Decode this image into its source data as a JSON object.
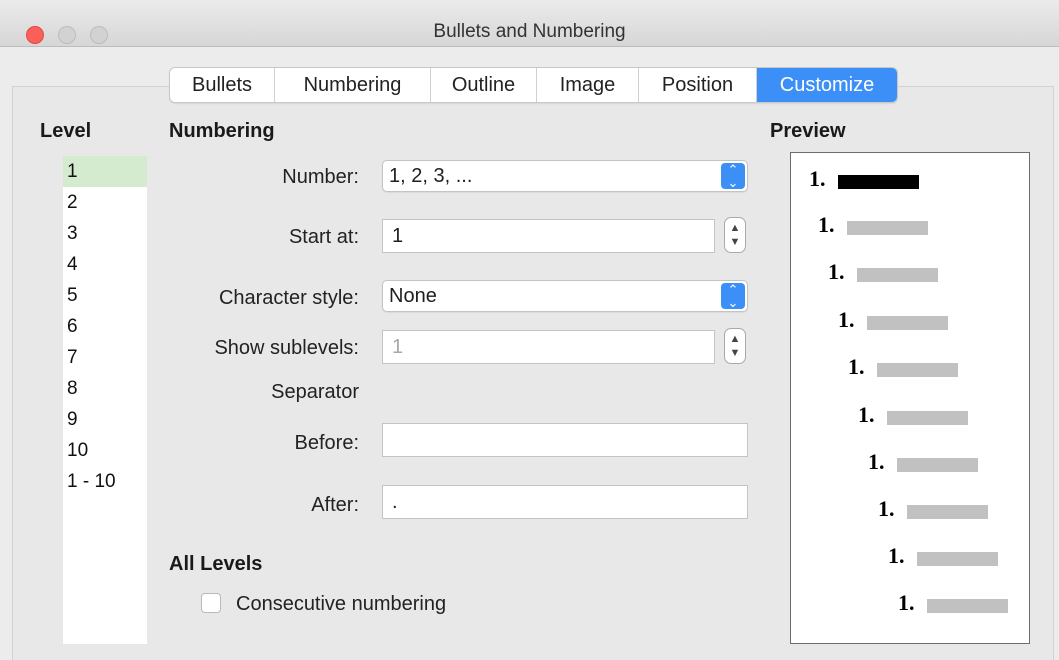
{
  "window": {
    "title": "Bullets and Numbering"
  },
  "tabs": [
    {
      "label": "Bullets",
      "active": false
    },
    {
      "label": "Numbering",
      "active": false
    },
    {
      "label": "Outline",
      "active": false
    },
    {
      "label": "Image",
      "active": false
    },
    {
      "label": "Position",
      "active": false
    },
    {
      "label": "Customize",
      "active": true
    }
  ],
  "level": {
    "heading": "Level",
    "items": [
      "1",
      "2",
      "3",
      "4",
      "5",
      "6",
      "7",
      "8",
      "9",
      "10",
      "1 - 10"
    ],
    "selected": "1"
  },
  "numbering": {
    "heading": "Numbering",
    "number_label": "Number:",
    "number_value": "1, 2, 3, ...",
    "start_at_label": "Start at:",
    "start_at_value": "1",
    "char_style_label": "Character style:",
    "char_style_value": "None",
    "show_sublevels_label": "Show sublevels:",
    "show_sublevels_value": "1",
    "separator_label": "Separator",
    "before_label": "Before:",
    "before_value": "",
    "after_label": "After:",
    "after_value": "."
  },
  "all_levels": {
    "heading": "All Levels",
    "consecutive_label": "Consecutive numbering",
    "consecutive_checked": false
  },
  "preview": {
    "heading": "Preview",
    "rows": [
      {
        "number": "1.",
        "highlight": true
      },
      {
        "number": "1.",
        "highlight": false
      },
      {
        "number": "1.",
        "highlight": false
      },
      {
        "number": "1.",
        "highlight": false
      },
      {
        "number": "1.",
        "highlight": false
      },
      {
        "number": "1.",
        "highlight": false
      },
      {
        "number": "1.",
        "highlight": false
      },
      {
        "number": "1.",
        "highlight": false
      },
      {
        "number": "1.",
        "highlight": false
      },
      {
        "number": "1.",
        "highlight": false
      }
    ]
  },
  "colors": {
    "accent": "#3b8ff7",
    "selected_level": "#d4ebd0",
    "close_button": "#fc5f57"
  }
}
